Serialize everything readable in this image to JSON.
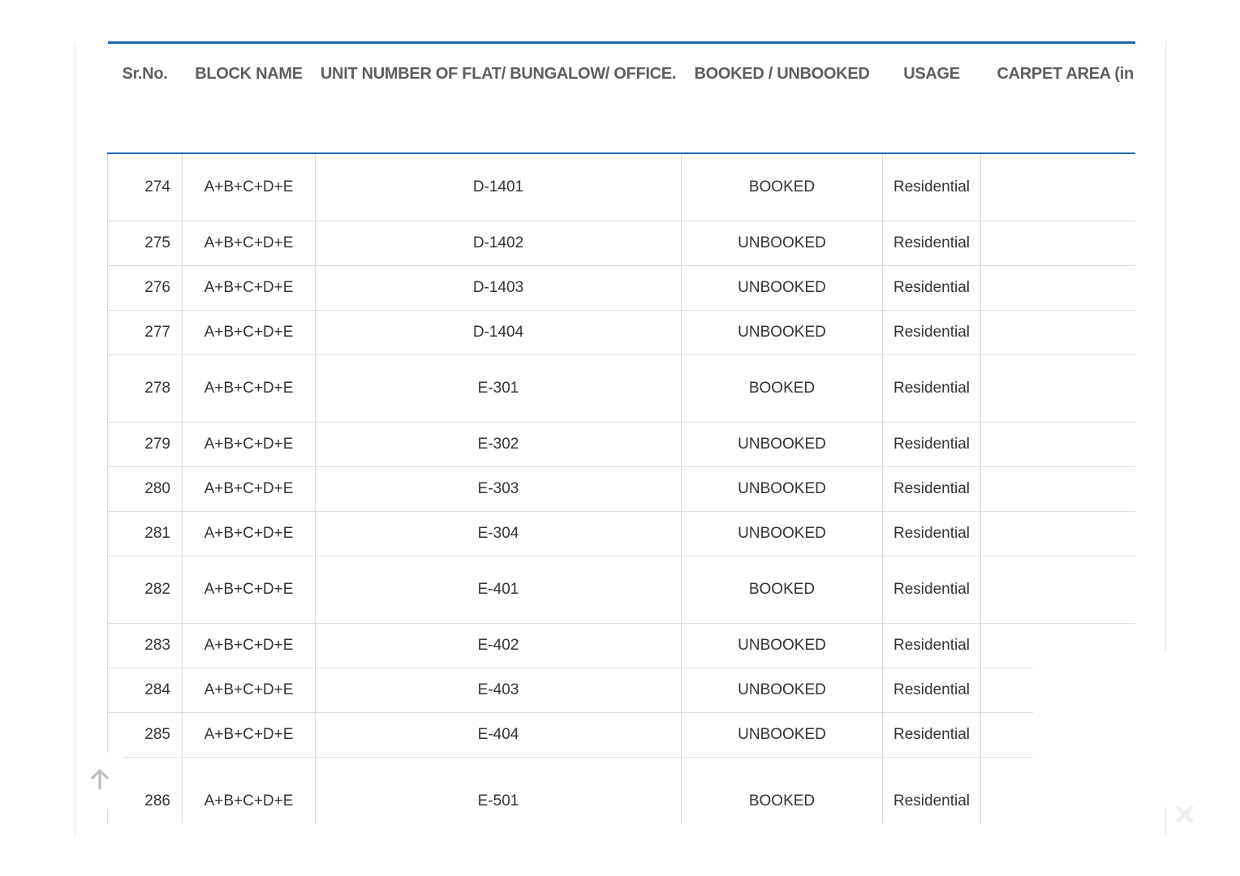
{
  "table": {
    "headers": {
      "sr_no": "Sr.No.",
      "block_name": "BLOCK NAME",
      "unit_number": "UNIT NUMBER OF FLAT/ BUNGALOW/ OFFICE.",
      "booked_unbooked": "BOOKED / UNBOOKED",
      "usage": "USAGE",
      "carpet_area": "CARPET AREA (in Sq"
    },
    "rows": [
      {
        "sr": "274",
        "block": "A+B+C+D+E",
        "unit": "D-1401",
        "status": "BOOKED",
        "usage": "Residential",
        "carpet": ""
      },
      {
        "sr": "275",
        "block": "A+B+C+D+E",
        "unit": "D-1402",
        "status": "UNBOOKED",
        "usage": "Residential",
        "carpet": ""
      },
      {
        "sr": "276",
        "block": "A+B+C+D+E",
        "unit": "D-1403",
        "status": "UNBOOKED",
        "usage": "Residential",
        "carpet": ""
      },
      {
        "sr": "277",
        "block": "A+B+C+D+E",
        "unit": "D-1404",
        "status": "UNBOOKED",
        "usage": "Residential",
        "carpet": ""
      },
      {
        "sr": "278",
        "block": "A+B+C+D+E",
        "unit": "E-301",
        "status": "BOOKED",
        "usage": "Residential",
        "carpet": ""
      },
      {
        "sr": "279",
        "block": "A+B+C+D+E",
        "unit": "E-302",
        "status": "UNBOOKED",
        "usage": "Residential",
        "carpet": ""
      },
      {
        "sr": "280",
        "block": "A+B+C+D+E",
        "unit": "E-303",
        "status": "UNBOOKED",
        "usage": "Residential",
        "carpet": ""
      },
      {
        "sr": "281",
        "block": "A+B+C+D+E",
        "unit": "E-304",
        "status": "UNBOOKED",
        "usage": "Residential",
        "carpet": ""
      },
      {
        "sr": "282",
        "block": "A+B+C+D+E",
        "unit": "E-401",
        "status": "BOOKED",
        "usage": "Residential",
        "carpet": ""
      },
      {
        "sr": "283",
        "block": "A+B+C+D+E",
        "unit": "E-402",
        "status": "UNBOOKED",
        "usage": "Residential",
        "carpet": ""
      },
      {
        "sr": "284",
        "block": "A+B+C+D+E",
        "unit": "E-403",
        "status": "UNBOOKED",
        "usage": "Residential",
        "carpet": ""
      },
      {
        "sr": "285",
        "block": "A+B+C+D+E",
        "unit": "E-404",
        "status": "UNBOOKED",
        "usage": "Residential",
        "carpet": ""
      },
      {
        "sr": "286",
        "block": "A+B+C+D+E",
        "unit": "E-501",
        "status": "BOOKED",
        "usage": "Residential",
        "carpet": ""
      }
    ]
  },
  "controls": {
    "scroll_top_icon": "arrow-up-icon",
    "close_icon": "close-icon"
  },
  "colors": {
    "header_rule": "#1f68b5",
    "header_text": "#5e5e5e",
    "cell_text": "#333333",
    "grid": "#dcdcdc",
    "muted_icon": "#bdbdbd"
  }
}
